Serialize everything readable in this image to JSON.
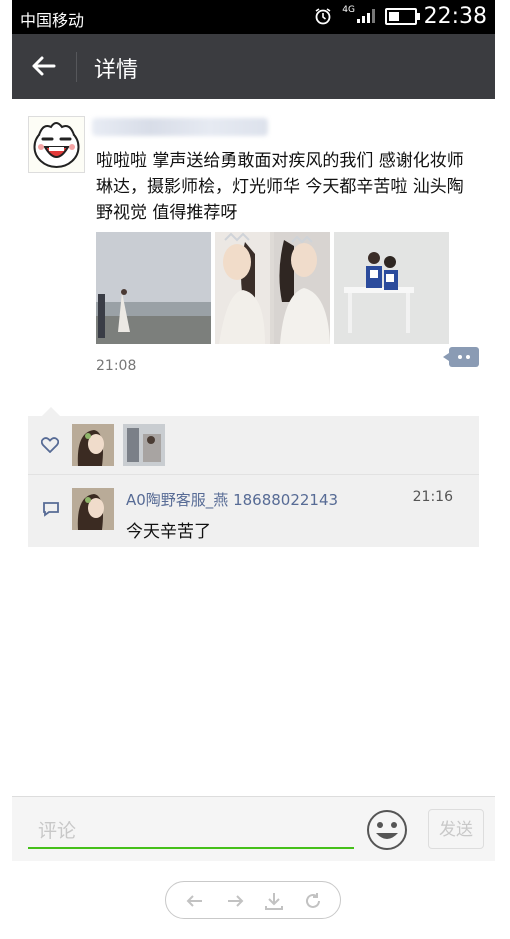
{
  "status_bar": {
    "carrier": "中国移动",
    "network": "4G",
    "time": "22:38"
  },
  "header": {
    "title": "详情"
  },
  "post": {
    "text": "啦啦啦 掌声送给勇敢面对疾风的我们 感谢化妆师琳达，摄影师桧，灯光师华 今天都辛苦啦 汕头陶野视觉 值得推荐呀",
    "time": "21:08",
    "photos": [
      {
        "name": "photo-beach",
        "colors": [
          "#c9cdd3",
          "#9da3a8",
          "#6f726f"
        ]
      },
      {
        "name": "photo-bride-1",
        "colors": [
          "#e9e6e4",
          "#c7b6a9",
          "#5a4a44"
        ]
      },
      {
        "name": "photo-bride-2",
        "colors": [
          "#d9d5d2",
          "#bba99a",
          "#3a2f2b"
        ]
      },
      {
        "name": "photo-couple",
        "colors": [
          "#e5e6e5",
          "#1f3c8c",
          "#f3f3f3"
        ]
      }
    ]
  },
  "comment": {
    "user": "A0陶野客服_燕 18688022143",
    "time": "21:16",
    "text": "今天辛苦了"
  },
  "composer": {
    "placeholder": "评论",
    "send_label": "发送"
  },
  "colors": {
    "nav_bg": "#3b3c40",
    "link": "#576b95",
    "input_underline": "#45c01a"
  }
}
